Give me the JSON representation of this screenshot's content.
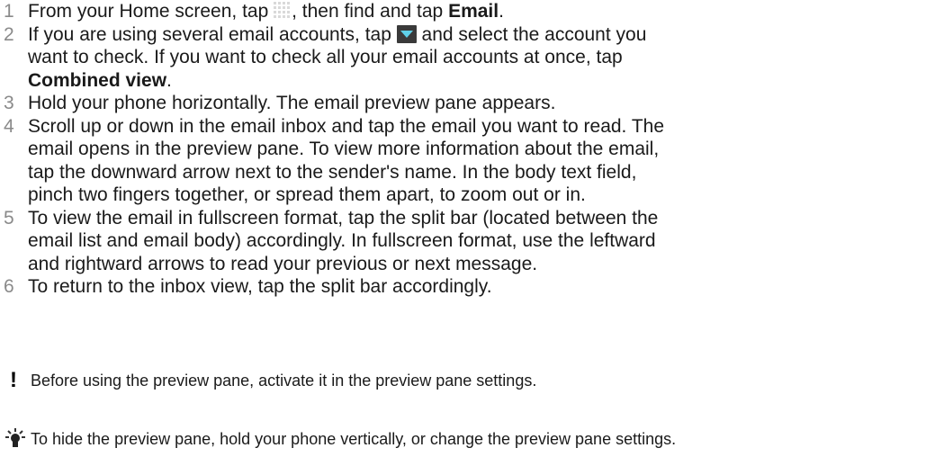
{
  "steps": [
    {
      "num": "1",
      "lines": [
        {
          "before": "From your Home screen, tap ",
          "icon": "apps-grid-icon",
          "after": ", then find and tap ",
          "bold": "Email",
          "end": "."
        }
      ]
    },
    {
      "num": "2",
      "lines": [
        {
          "before": "If you are using several email accounts, tap ",
          "icon": "dropdown-arrow-icon",
          "after": " and select the account you"
        },
        {
          "text": "want to check. If you want to check all your email accounts at once, tap"
        },
        {
          "bold": "Combined view",
          "end": "."
        }
      ]
    },
    {
      "num": "3",
      "lines": [
        {
          "text": "Hold your phone horizontally. The email preview pane appears."
        }
      ]
    },
    {
      "num": "4",
      "lines": [
        {
          "text": "Scroll up or down in the email inbox and tap the email you want to read. The"
        },
        {
          "text": "email opens in the preview pane. To view more information about the email,"
        },
        {
          "text": "tap the downward arrow next to the sender's name. In the body text field,"
        },
        {
          "text": "pinch two fingers together, or spread them apart, to zoom out or in."
        }
      ]
    },
    {
      "num": "5",
      "lines": [
        {
          "text": "To view the email in fullscreen format, tap the split bar (located between the"
        },
        {
          "text": "email list and email body) accordingly. In fullscreen format, use the leftward"
        },
        {
          "text": "and rightward arrows to read your previous or next message."
        }
      ]
    },
    {
      "num": "6",
      "lines": [
        {
          "text": "To return to the inbox view, tap the split bar accordingly."
        }
      ]
    }
  ],
  "notes": {
    "warning": {
      "icon": "exclamation-icon",
      "mark": "!",
      "text": "Before using the preview pane, activate it in the preview pane settings."
    },
    "tip": {
      "icon": "lightbulb-tip-icon",
      "text": "To hide the preview pane, hold your phone vertically, or change the preview pane settings."
    }
  }
}
